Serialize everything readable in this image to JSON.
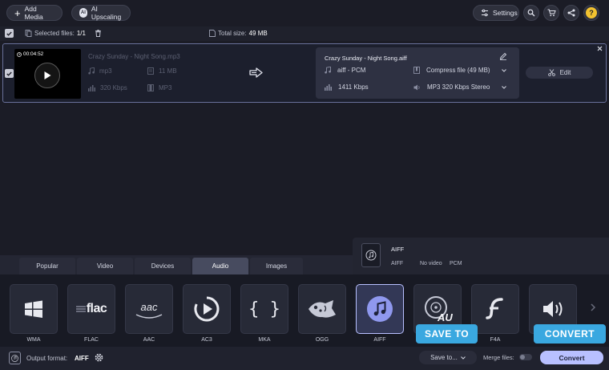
{
  "toolbar": {
    "add_media": "Add Media",
    "ai_upscaling": "AI Upscaling",
    "settings": "Settings"
  },
  "selection": {
    "selected_label": "Selected files:",
    "selected_value": "1/1",
    "total_label": "Total size:",
    "total_value": "49 MB"
  },
  "file": {
    "duration": "00:04:52",
    "name": "Crazy Sunday - Night Song.mp3",
    "format": "mp3",
    "size": "11 MB",
    "bitrate": "320 Kbps",
    "container": "MP3"
  },
  "output": {
    "name": "Crazy Sunday - Night Song.aiff",
    "codec": "aiff - PCM",
    "bitrate": "1411 Kbps",
    "compress_option": "Compress file (49 MB)",
    "audio_option": "MP3 320 Kbps Stereo",
    "edit_label": "Edit"
  },
  "format_tabs": [
    "Popular",
    "Video",
    "Devices",
    "Audio",
    "Images"
  ],
  "active_tab": "Audio",
  "format_info": {
    "title": "AIFF",
    "codec": "AIFF",
    "video": "No video",
    "audio": "PCM"
  },
  "formats": [
    {
      "label": "WMA",
      "icon": "windows-icon"
    },
    {
      "label": "FLAC",
      "icon": "flac-icon"
    },
    {
      "label": "AAC",
      "icon": "aac-icon"
    },
    {
      "label": "AC3",
      "icon": "ac3-icon"
    },
    {
      "label": "MKA",
      "icon": "mka-icon"
    },
    {
      "label": "OGG",
      "icon": "ogg-icon"
    },
    {
      "label": "AIFF",
      "icon": "music-note-icon"
    },
    {
      "label": "",
      "icon": "au-icon"
    },
    {
      "label": "F4A",
      "icon": "flash-icon"
    },
    {
      "label": "",
      "icon": "speaker-icon"
    }
  ],
  "format_text": {
    "flac": "flac",
    "aac": "aac",
    "au": "AU"
  },
  "selected_format": "AIFF",
  "bottom": {
    "output_format_label": "Output format:",
    "output_format_value": "AIFF",
    "save_to": "Save to...",
    "merge_files": "Merge files:",
    "convert": "Convert"
  },
  "callouts": {
    "save_to": "SAVE TO",
    "convert": "CONVERT"
  },
  "colors": {
    "accent": "#b8c0ff",
    "callout": "#3aa8e0",
    "help": "#f2c230"
  }
}
